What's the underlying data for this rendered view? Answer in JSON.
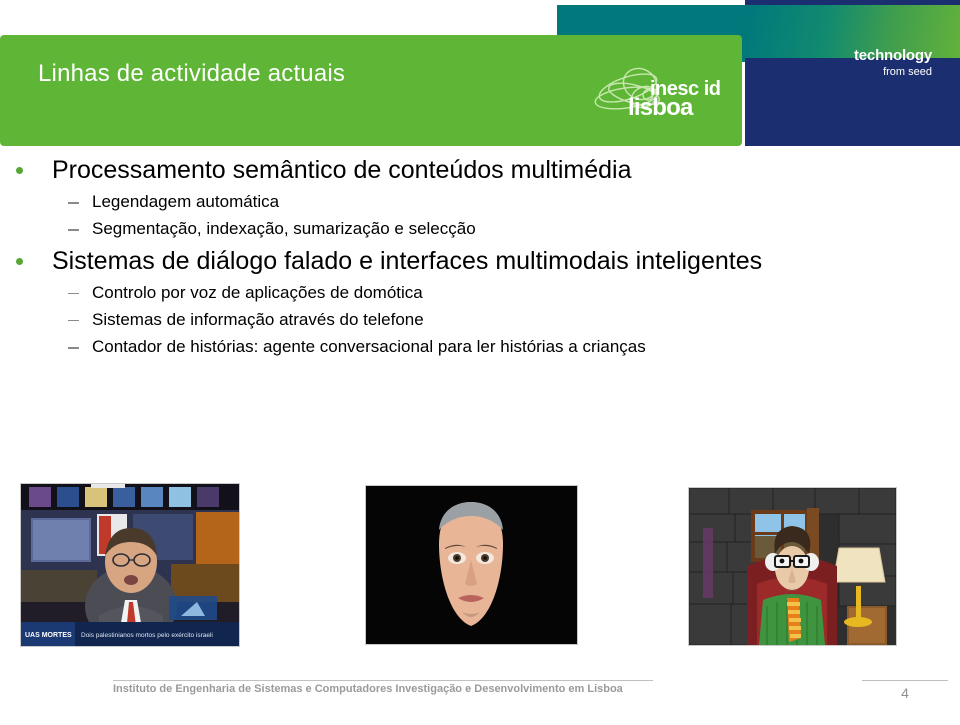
{
  "slide": {
    "title": "Linhas de actividade actuais",
    "page_number": "4"
  },
  "brand": {
    "logo_inesc_id": "inesc id",
    "logo_lisboa": "lisboa",
    "tagline_main": "technology",
    "tagline_sub": "from seed",
    "green": "#5fb636",
    "teal": "#00787c",
    "navy": "#1b2f70",
    "bullet_green": "#55a832"
  },
  "content": {
    "groups": [
      {
        "heading": "Processamento semântico de conteúdos multimédia",
        "sub_items": [
          "Legendagem automática",
          "Segmentação, indexação, sumarização e selecção"
        ]
      },
      {
        "heading": "Sistemas de diálogo falado e interfaces multimodais inteligentes",
        "sub_items": [
          "Controlo por voz de aplicações de domótica",
          "Sistemas de informação através do telefone",
          "Contador de histórias: agente conversacional para ler histórias a crianças"
        ]
      }
    ]
  },
  "images": [
    {
      "name": "news-anchor-broadcast",
      "ticker": "Dois palestinianos mortos pelo exército israelita"
    },
    {
      "name": "talking-head-avatar"
    },
    {
      "name": "storyteller-agent"
    }
  ],
  "footer": {
    "organization": "Instituto de Engenharia de Sistemas e Computadores Investigação e Desenvolvimento em Lisboa"
  }
}
